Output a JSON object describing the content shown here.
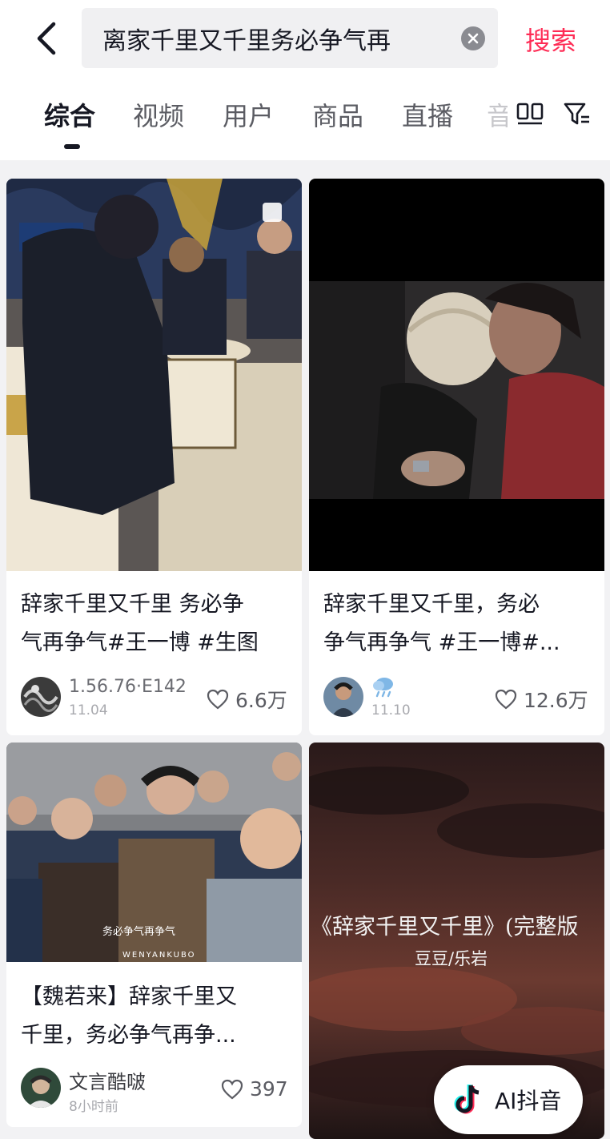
{
  "search": {
    "query": "离家千里又千里务必争气再",
    "button_label": "搜索"
  },
  "tabs": [
    {
      "label": "综合",
      "active": true
    },
    {
      "label": "视频",
      "active": false
    },
    {
      "label": "用户",
      "active": false
    },
    {
      "label": "商品",
      "active": false
    },
    {
      "label": "直播",
      "active": false
    },
    {
      "label": "音",
      "active": false
    }
  ],
  "cards": [
    {
      "title_line1": "辞家千里又千里 务必争",
      "title_line2": "气再争气#王一博 #生图",
      "author": "1.56.76·E142",
      "date": "11.04",
      "likes": "6.6万",
      "thumb_desc": "banquet-photo"
    },
    {
      "title_line1": "辞家千里又千里，务必",
      "title_line2": "争气再争气 #王一博#...",
      "author": "",
      "author_icon": "weather-cloud-icon",
      "date": "11.10",
      "likes": "12.6万",
      "thumb_desc": "hug-video"
    },
    {
      "title_line1": "【魏若来】辞家千里又",
      "title_line2": "千里，务必争气再争...",
      "author": "文言酷啵",
      "date": "8小时前",
      "likes": "397",
      "thumb_caption": "务必争气再争气",
      "thumb_watermark": "WENYANKUBO"
    },
    {
      "thumb_title": "《辞家千里又千里》(完整版",
      "thumb_subtitle": "豆豆/乐岩"
    }
  ],
  "ai_badge": {
    "label": "AI抖音"
  },
  "colors": {
    "accent": "#fe2c55",
    "text": "#161823",
    "muted": "#5b5c63"
  }
}
